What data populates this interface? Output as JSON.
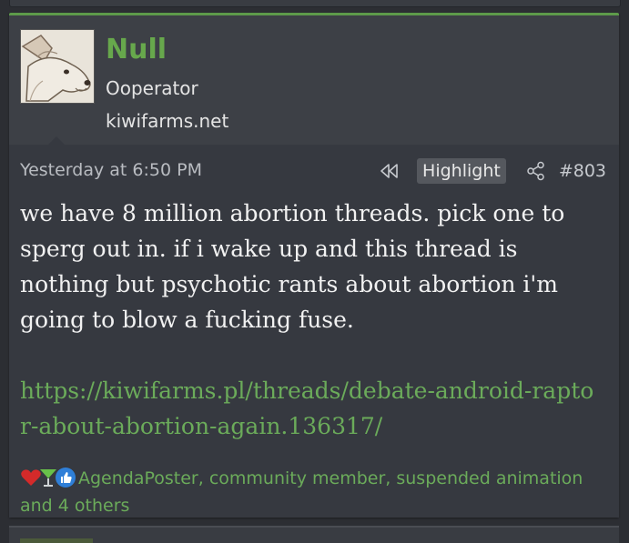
{
  "post": {
    "username": "Null",
    "user_title": "Ooperator",
    "user_blurb": "kiwifarms.net",
    "timestamp": "Yesterday at 6:50 PM",
    "highlight_label": "Highlight",
    "post_number": "#803",
    "message_text": "we have 8 million abortion threads. pick one to sperg out in. if i wake up and this thread is nothing but psychotic rants about abortion i'm going to blow a fucking fuse.",
    "link_text": "https://kiwifarms.pl/threads/debate-android-raptor-about-abortion-again.136317/",
    "reactions_text": "AgendaPoster, community member, suspended animation and 4 others",
    "reaction_icons": [
      "heart-icon",
      "cocktail-icon",
      "thumbs-up-icon"
    ]
  },
  "colors": {
    "accent_green": "#67a84c",
    "link_green": "#6bab5a",
    "background": "#2c2e33",
    "post_body": "#363940",
    "user_bar": "#3d4046"
  }
}
